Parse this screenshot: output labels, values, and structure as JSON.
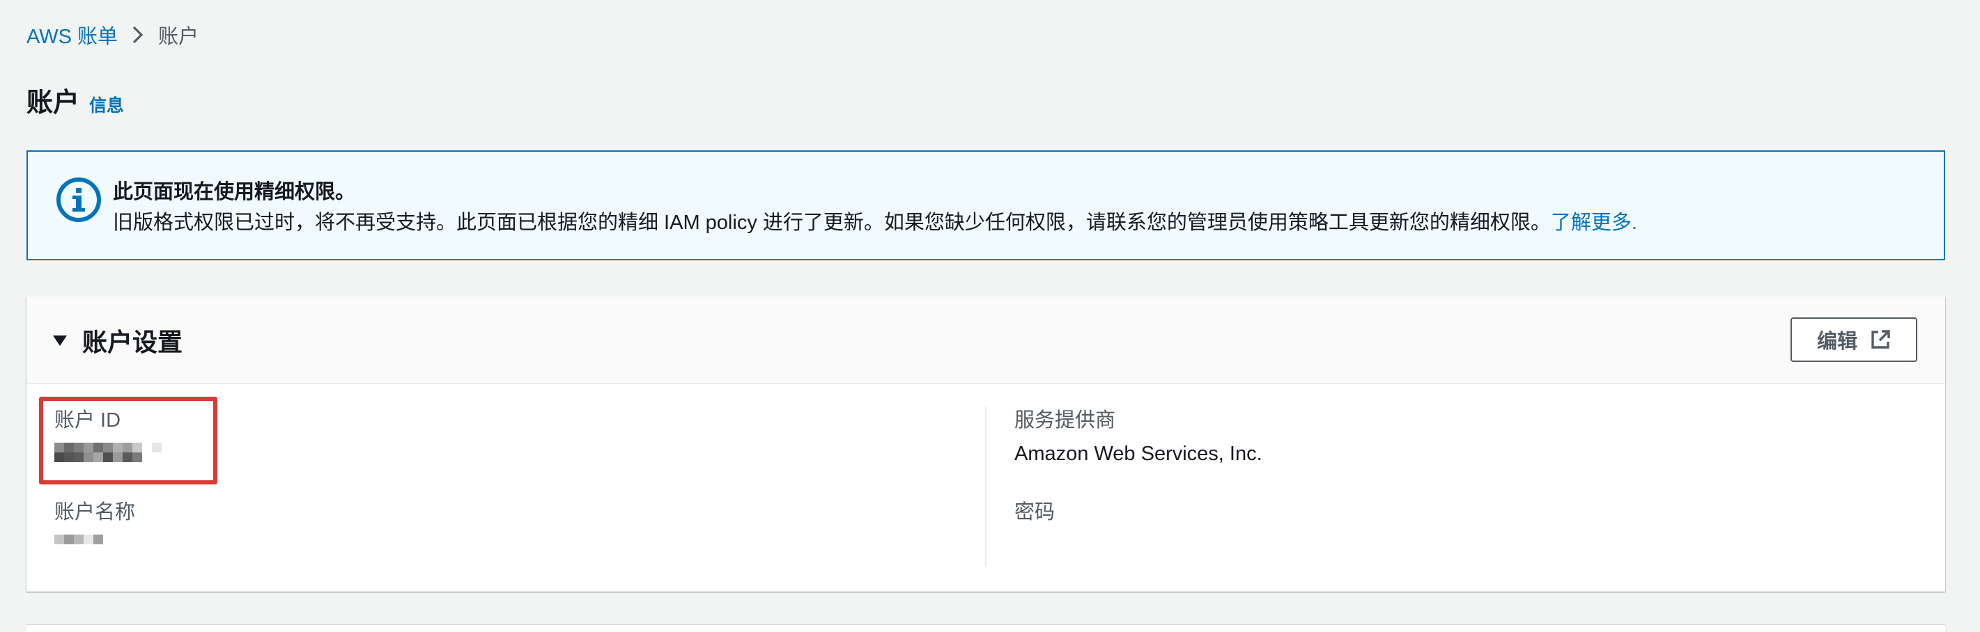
{
  "breadcrumb": {
    "root": "AWS 账单",
    "current": "账户"
  },
  "page": {
    "title": "账户",
    "info_link": "信息"
  },
  "alert": {
    "title": "此页面现在使用精细权限。",
    "text": "旧版格式权限已过时，将不再受支持。此页面已根据您的精细 IAM policy 进行了更新。如果您缺少任何权限，请联系您的管理员使用策略工具更新您的精细权限。",
    "link": "了解更多."
  },
  "account_settings": {
    "title": "账户设置",
    "edit_label": "编辑",
    "account_id_label": "账户 ID",
    "account_name_label": "账户名称",
    "provider_label": "服务提供商",
    "provider_value": "Amazon Web Services, Inc.",
    "password_label": "密码"
  },
  "colors": {
    "link": "#0073bb",
    "alert_border": "#0073bb",
    "alert_bg": "#f1faff",
    "highlight": "#d93a35",
    "page_bg": "#f2f3f3"
  }
}
